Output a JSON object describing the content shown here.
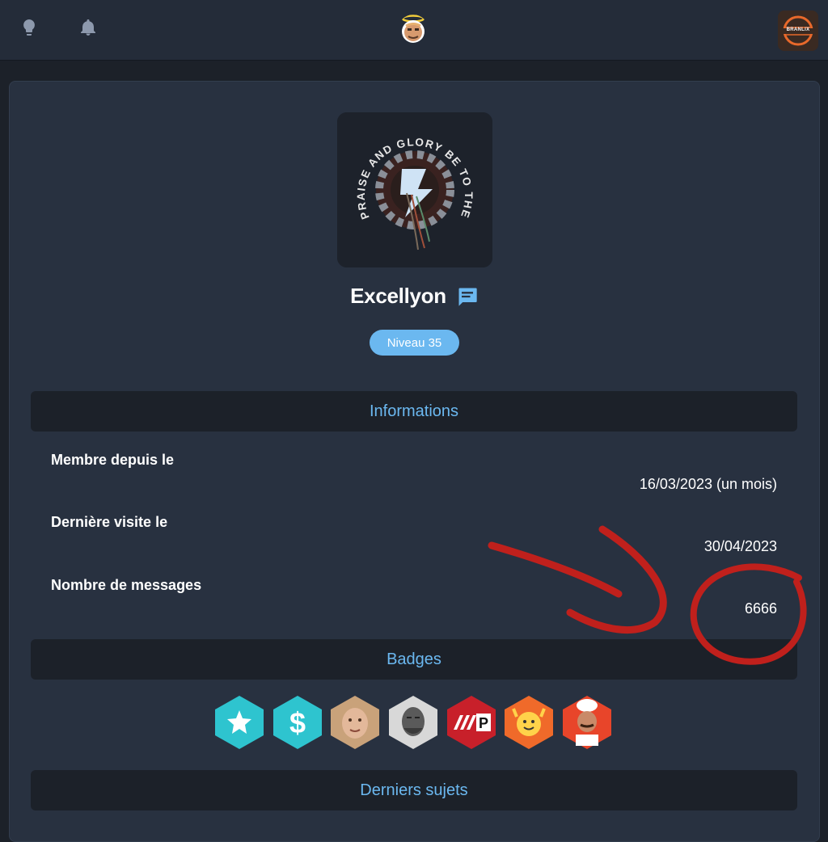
{
  "topbar": {
    "icons": [
      "lightbulb-icon",
      "bell-icon"
    ],
    "center_avatar": "halo-avatar",
    "user_avatar_text": "BRANLIX"
  },
  "profile": {
    "image_text": "PRAISE AND GLORY BE TO THE MACHINE GOD",
    "username": "Excellyon",
    "level": "Niveau 35"
  },
  "sections": {
    "info_title": "Informations",
    "badges_title": "Badges",
    "topics_title": "Derniers sujets"
  },
  "info": [
    {
      "label": "Membre depuis le",
      "value": "16/03/2023 (un mois)"
    },
    {
      "label": "Dernière visite le",
      "value": "30/04/2023"
    },
    {
      "label": "Nombre de messages",
      "value": "6666"
    }
  ],
  "badges": [
    "star-badge",
    "dollar-badge",
    "face-badge",
    "chad-badge",
    "p-badge",
    "emoji-badge",
    "chef-badge"
  ],
  "colors": {
    "accent": "#6bb8f0",
    "background": "#1c2129",
    "card": "#283140",
    "topbar": "#242c39",
    "annotation": "#c0201c"
  }
}
